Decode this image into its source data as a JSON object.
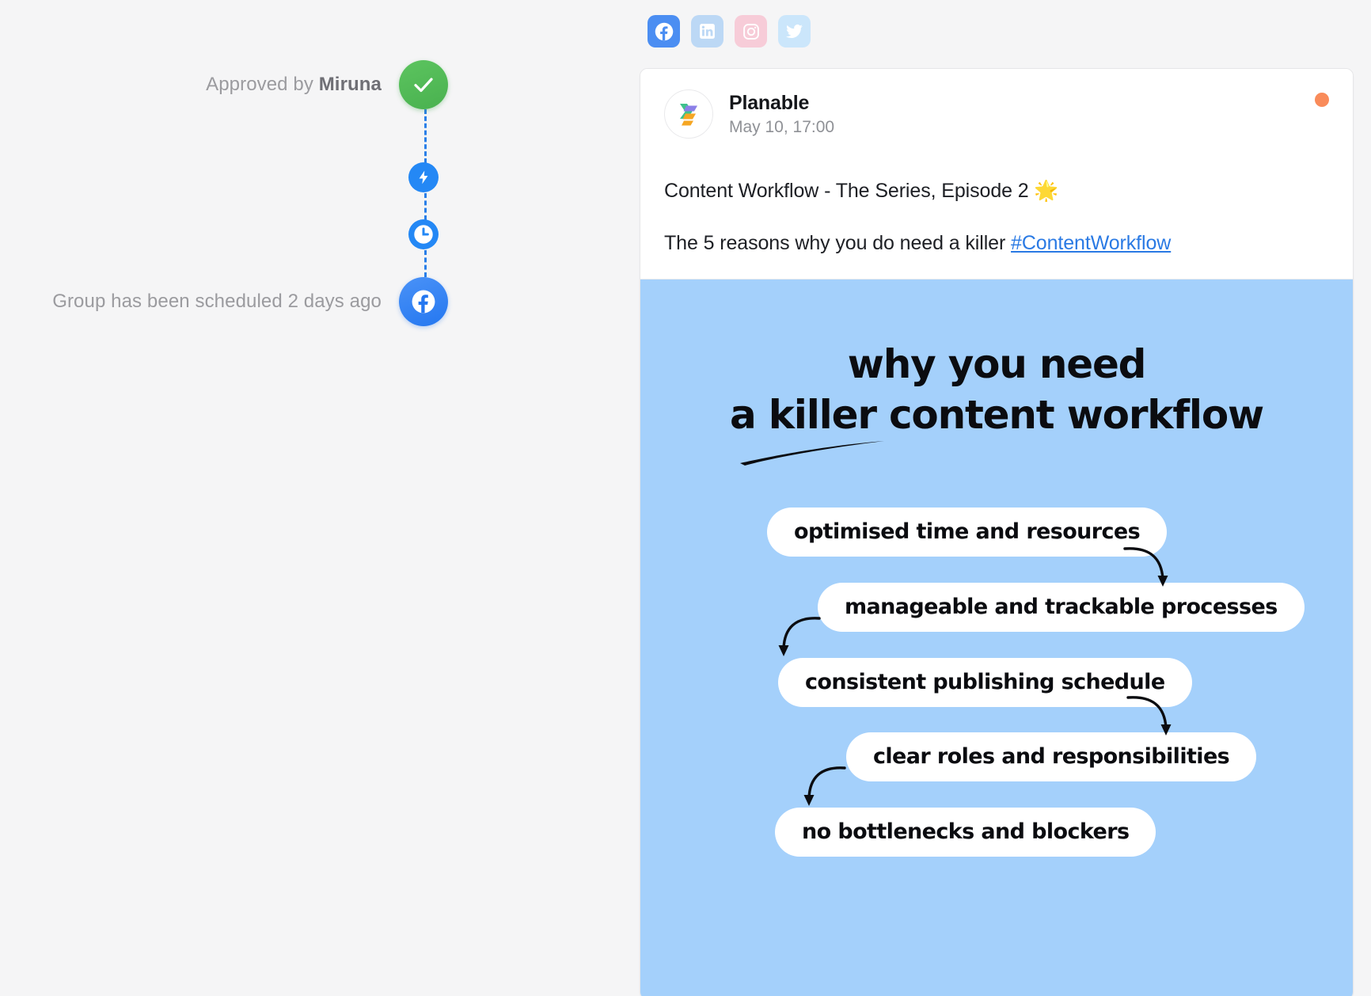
{
  "social_tabs": [
    {
      "name": "facebook",
      "label": "Facebook",
      "state": "active",
      "color": "#4b8ef2"
    },
    {
      "name": "linkedin",
      "label": "LinkedIn",
      "state": "inactive",
      "color": "#bcd8f5"
    },
    {
      "name": "instagram",
      "label": "Instagram",
      "state": "inactive",
      "color": "#f7ccd8"
    },
    {
      "name": "twitter",
      "label": "Twitter",
      "state": "inactive",
      "color": "#cbe6fb"
    }
  ],
  "timeline": {
    "items": [
      {
        "label_prefix": "Approved by ",
        "label_strong": "Miruna",
        "icon": "check-icon",
        "type": "approved"
      },
      {
        "label_prefix": "",
        "label_strong": "",
        "icon": "lightning-icon",
        "type": "auto"
      },
      {
        "label_prefix": "",
        "label_strong": "",
        "icon": "clock-icon",
        "type": "scheduled"
      },
      {
        "label_prefix": "Group has been scheduled 2 days ago",
        "label_strong": "",
        "icon": "facebook-icon",
        "type": "published"
      }
    ]
  },
  "post": {
    "author": "Planable",
    "timestamp": "May 10, 17:00",
    "status_color": "#f98b5a",
    "text_line_1": "Content Workflow - The Series, Episode 2 🌟",
    "text_line_2_prefix": "The 5 reasons why you do need a killer ",
    "text_line_2_hashtag": "#ContentWorkflow"
  },
  "creative": {
    "background": "#a4d0fb",
    "headline_1": "why you need",
    "headline_2": "a killer content workflow",
    "pills": [
      "optimised time and resources",
      "manageable and trackable processes",
      "consistent publishing schedule",
      "clear roles and responsibilities",
      "no bottlenecks and blockers"
    ]
  }
}
